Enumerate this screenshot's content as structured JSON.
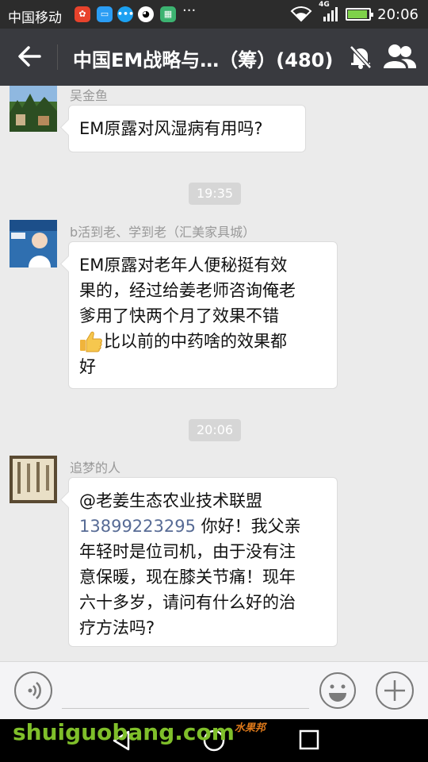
{
  "status_bar": {
    "carrier": "中国移动",
    "network": "4G",
    "time": "20:06",
    "more": "···"
  },
  "header": {
    "title": "中国EM战略与…（筹）(480)"
  },
  "messages": [
    {
      "sender": "吴金鱼",
      "text": "EM原露对风湿病有用吗?"
    },
    {
      "timestamp": "19:35"
    },
    {
      "sender": "b活到老、学到老（汇美家具城）",
      "lines": [
        "EM原露对老年人便秘挺有效",
        "果的，经过给姜老师咨询俺老",
        "爹用了快两个月了效果不错",
        "比以前的中药啥的效果都",
        "好"
      ]
    },
    {
      "timestamp": "20:06"
    },
    {
      "sender": "追梦的人",
      "lines": [
        "@老姜生态农业技术联盟",
        " 你好！我父亲",
        "年轻时是位司机，由于没有注",
        "意保暖，现在膝关节痛！现年",
        "六十多岁，请问有什么好的治",
        "疗方法吗?"
      ],
      "phone": "13899223295"
    }
  ],
  "watermark": {
    "text": "shuiguobang.com",
    "cn": "水果邦"
  },
  "colors": {
    "header_bg": "#393a3f",
    "chat_bg": "#ebebeb",
    "link": "#576b95"
  }
}
